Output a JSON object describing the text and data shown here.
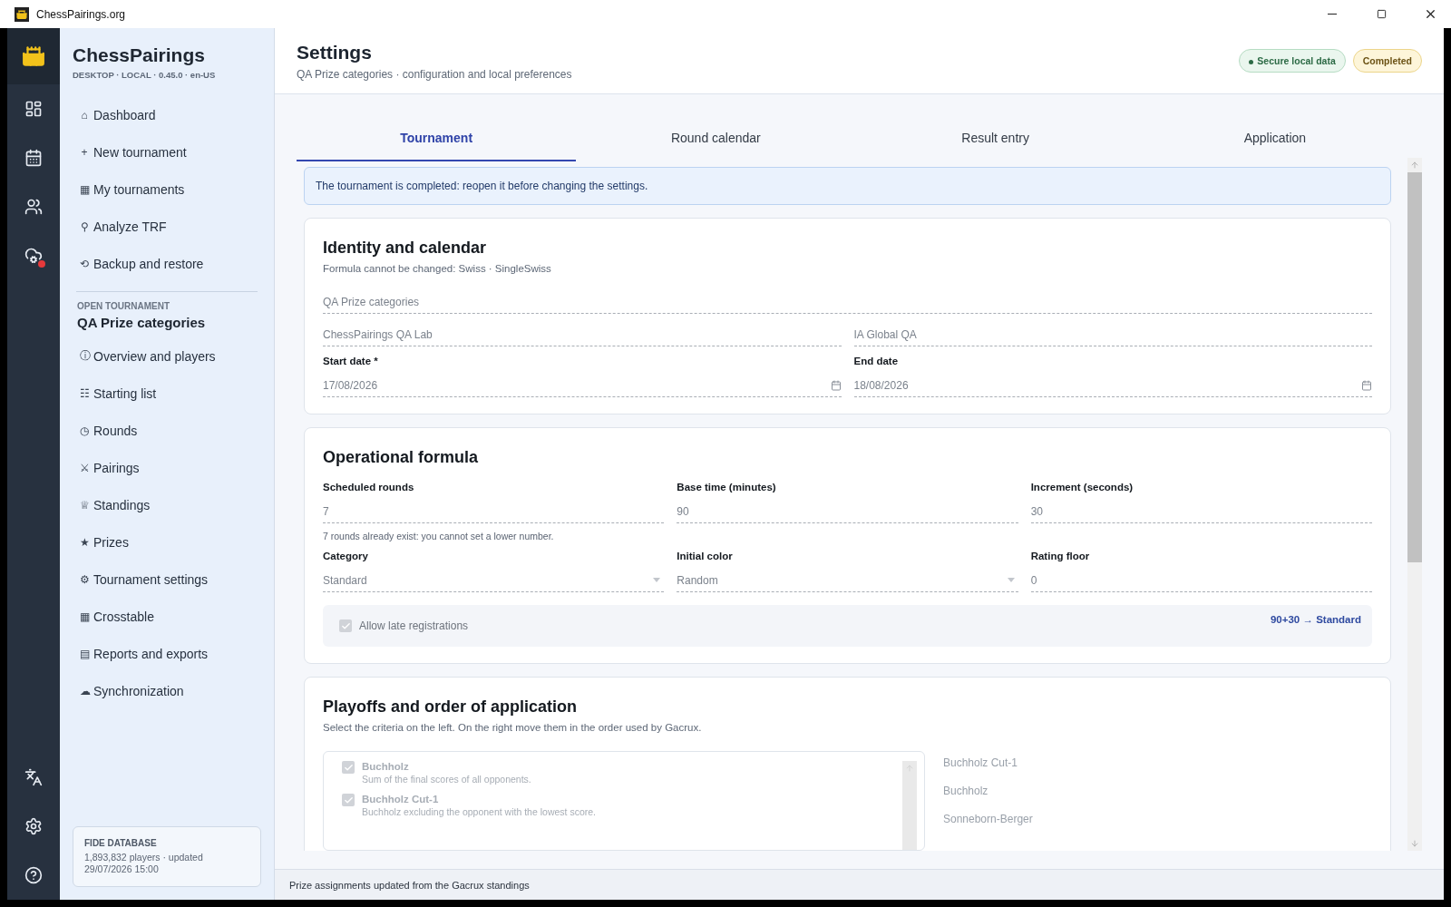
{
  "titlebar": {
    "title": "ChessPairings.org"
  },
  "rail": {
    "sync_alert": true
  },
  "brand": {
    "name": "ChessPairings",
    "subtitle": "DESKTOP · LOCAL · 0.45.0 · en-US"
  },
  "nav": [
    {
      "icon": "⌂",
      "label": "Dashboard"
    },
    {
      "icon": "+",
      "label": "New tournament"
    },
    {
      "icon": "▦",
      "label": "My tournaments"
    },
    {
      "icon": "⚲",
      "label": "Analyze TRF"
    },
    {
      "icon": "⟲",
      "label": "Backup and restore"
    }
  ],
  "open_tournament": {
    "label": "OPEN TOURNAMENT",
    "name": "QA Prize categories",
    "items": [
      {
        "icon": "ⓘ",
        "label": "Overview and players"
      },
      {
        "icon": "☷",
        "label": "Starting list"
      },
      {
        "icon": "◷",
        "label": "Rounds"
      },
      {
        "icon": "⚔",
        "label": "Pairings"
      },
      {
        "icon": "♕",
        "label": "Standings"
      },
      {
        "icon": "★",
        "label": "Prizes"
      },
      {
        "icon": "⚙",
        "label": "Tournament settings"
      },
      {
        "icon": "▦",
        "label": "Crosstable"
      },
      {
        "icon": "▤",
        "label": "Reports and exports"
      },
      {
        "icon": "☁",
        "label": "Synchronization"
      }
    ]
  },
  "fide": {
    "title": "FIDE DATABASE",
    "text": "1,893,832 players · updated 29/07/2026 15:00"
  },
  "header": {
    "title": "Settings",
    "subtitle": "QA Prize categories · configuration and local preferences",
    "badges": [
      {
        "kind": "secure",
        "label": "Secure local data"
      },
      {
        "kind": "status",
        "label": "Completed"
      }
    ]
  },
  "tabs": [
    {
      "label": "Tournament",
      "selected": true
    },
    {
      "label": "Round calendar",
      "selected": false
    },
    {
      "label": "Result entry",
      "selected": false
    },
    {
      "label": "Application",
      "selected": false
    }
  ],
  "notice": "The tournament is completed: reopen it before changing the settings.",
  "form_disabled": true,
  "identity": {
    "title": "Identity and calendar",
    "subtitle": "Formula cannot be changed: Swiss · SingleSwiss",
    "rows": [
      [
        {
          "kind": "text",
          "value": "QA Prize categories"
        }
      ],
      [
        {
          "kind": "text",
          "value": "ChessPairings QA Lab"
        },
        {
          "kind": "text",
          "value": "IA Global QA"
        }
      ],
      [
        {
          "kind": "date",
          "label": "Start date *",
          "value": "17/08/2026"
        },
        {
          "kind": "date",
          "label": "End date",
          "value": "18/08/2026"
        }
      ]
    ]
  },
  "formula": {
    "title": "Operational formula",
    "rows": [
      {
        "fields": [
          {
            "kind": "text",
            "label": "Scheduled rounds",
            "value": "7"
          },
          {
            "kind": "text",
            "label": "Base time (minutes)",
            "value": "90"
          },
          {
            "kind": "text",
            "label": "Increment (seconds)",
            "value": "30"
          }
        ],
        "hint": "7 rounds already exist: you cannot set a lower number."
      },
      {
        "fields": [
          {
            "kind": "select",
            "label": "Category",
            "value": "Standard"
          },
          {
            "kind": "select",
            "label": "Initial color",
            "value": "Random"
          },
          {
            "kind": "text",
            "label": "Rating floor",
            "value": "0"
          }
        ]
      }
    ],
    "late_registrations": {
      "label": "Allow late registrations",
      "checked": true,
      "disabled": true
    },
    "summary": "90+30 → Standard"
  },
  "playoffs": {
    "title": "Playoffs and order of application",
    "subtitle": "Select the criteria on the left. On the right move them in the order used by Gacrux.",
    "criteria": [
      {
        "name": "Buchholz",
        "description": "Sum of the final scores of all opponents.",
        "checked": true,
        "disabled": true
      },
      {
        "name": "Buchholz Cut-1",
        "description": "Buchholz excluding the opponent with the lowest score.",
        "checked": true,
        "disabled": true
      }
    ],
    "order": [
      "Buchholz Cut-1",
      "Buchholz",
      "Sonneborn-Berger"
    ]
  },
  "status_bar": "Prize assignments updated from the Gacrux standings"
}
